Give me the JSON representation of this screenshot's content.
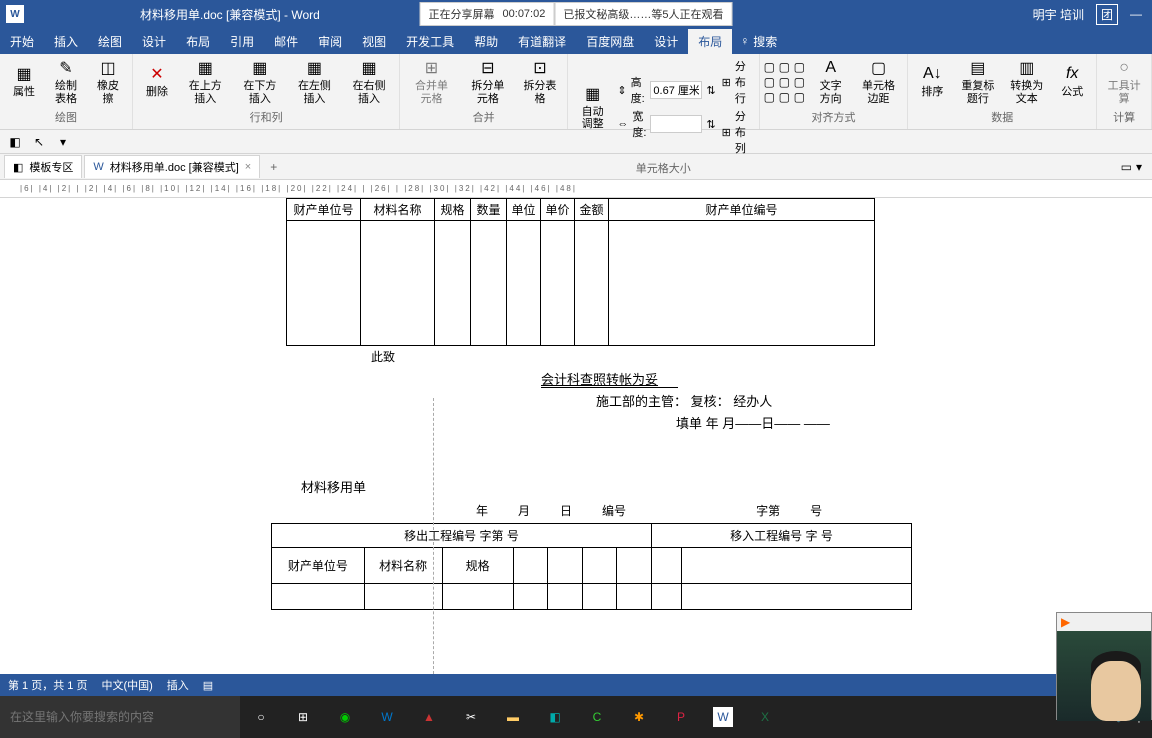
{
  "titlebar": {
    "doc_title": "材料移用单.doc [兼容模式] - Word",
    "sharing": "正在分享屏幕",
    "timer": "00:07:02",
    "viewers": "已报文秘高级……等5人正在观看",
    "user": "明宇 培训"
  },
  "menu": {
    "items": [
      "开始",
      "插入",
      "绘图",
      "设计",
      "布局",
      "引用",
      "邮件",
      "审阅",
      "视图",
      "开发工具",
      "帮助",
      "有道翻译",
      "百度网盘",
      "设计",
      "布局"
    ],
    "search_hint": "搜索"
  },
  "ribbon": {
    "groups": {
      "biaoge": {
        "btns": [
          {
            "l": "属性",
            "i": "▦"
          },
          {
            "l": "绘制表格",
            "i": "✎"
          },
          {
            "l": "橡皮擦",
            "i": "◫"
          }
        ],
        "label": "绘图"
      },
      "hanglie": {
        "btns": [
          {
            "l": "删除",
            "i": "✕"
          },
          {
            "l": "在上方插入",
            "i": "⬆"
          },
          {
            "l": "在下方插入",
            "i": "⬇"
          },
          {
            "l": "在左侧插入",
            "i": "⬅"
          },
          {
            "l": "在右侧插入",
            "i": "➡"
          }
        ],
        "label": "行和列"
      },
      "hebing": {
        "btns": [
          {
            "l": "合并单元格",
            "i": "⊞"
          },
          {
            "l": "拆分单元格",
            "i": "⊟"
          },
          {
            "l": "拆分表格",
            "i": "⊡"
          }
        ],
        "label": "合并"
      },
      "daxiao": {
        "auto": "自动调整",
        "height_l": "高度:",
        "height_v": "0.67 厘米",
        "width_l": "宽度:",
        "width_v": "",
        "dist_row": "分布行",
        "dist_col": "分布列",
        "label": "单元格大小"
      },
      "duiqi": {
        "btns": [
          {
            "l": "",
            "i": "▦"
          },
          {
            "l": "文字方向",
            "i": "A"
          },
          {
            "l": "单元格边距",
            "i": "▢"
          }
        ],
        "label": "对齐方式"
      },
      "shuju": {
        "btns": [
          {
            "l": "排序",
            "i": "A↓"
          },
          {
            "l": "重复标题行",
            "i": "▤"
          },
          {
            "l": "转换为文本",
            "i": "▥"
          },
          {
            "l": "公式",
            "i": "fx"
          }
        ],
        "label": "数据"
      },
      "jisuan": {
        "btns": [
          {
            "l": "工具计算",
            "i": "○"
          }
        ],
        "label": "计算"
      }
    }
  },
  "tabs": {
    "t1": "模板专区",
    "t2": "材料移用单.doc [兼容模式]"
  },
  "ruler_marks": [
    "|6|",
    "|4|",
    "|2|",
    "|",
    "|2|",
    "|4|",
    "|6|",
    "|8|",
    "|10|",
    "|12|",
    "|14|",
    "|16|",
    "|18|",
    "|20|",
    "|22|",
    "|24|",
    "|",
    "|26|",
    "|",
    "|28|",
    "|30|",
    "|32|",
    "|42|",
    "|44|",
    "|46|",
    "|48|"
  ],
  "doc": {
    "table1": {
      "headers": [
        "财产单位号",
        "材料名称",
        "规格",
        "数量",
        "单位",
        "单价",
        "金额",
        "财产单位编号"
      ]
    },
    "text": {
      "cizhi": "此致",
      "kuaiji": "会计科查照转帐为妥",
      "shigong": "施工部的主管：  复核：   经办人",
      "tiandan": "填单      年      月——日——    ——"
    },
    "form2": {
      "title": "材料移用单",
      "date_parts": [
        "年",
        "月",
        "日",
        "编号",
        "字第",
        "号"
      ],
      "header1": [
        "移出工程编号    字第    号",
        "移入工程编号    字    号"
      ],
      "header2": [
        "财产单位号",
        "材料名称",
        "规格",
        "",
        "",
        "",
        "",
        "",
        ""
      ]
    }
  },
  "status": {
    "page": "第 1 页，共 1 页",
    "lang": "中文(中国)",
    "mode": "插入"
  },
  "taskbar": {
    "search_placeholder": "在这里输入你要搜索的内容"
  }
}
